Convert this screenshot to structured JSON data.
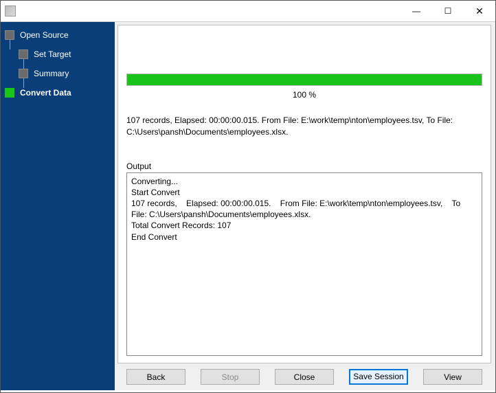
{
  "sidebar": {
    "items": [
      {
        "label": "Open Source",
        "active": false,
        "sub": false
      },
      {
        "label": "Set Target",
        "active": false,
        "sub": true
      },
      {
        "label": "Summary",
        "active": false,
        "sub": true
      },
      {
        "label": "Convert Data",
        "active": true,
        "sub": false
      }
    ]
  },
  "progress": {
    "percent_text": "100 %",
    "percent_value": 100
  },
  "status_line": "107 records,    Elapsed: 00:00:00.015.    From File: E:\\work\\temp\\nton\\employees.tsv,    To File: C:\\Users\\pansh\\Documents\\employees.xlsx.",
  "output_label": "Output",
  "output_text": "Converting...\nStart Convert\n107 records,    Elapsed: 00:00:00.015.    From File: E:\\work\\temp\\nton\\employees.tsv,    To File: C:\\Users\\pansh\\Documents\\employees.xlsx.\nTotal Convert Records: 107\nEnd Convert",
  "buttons": {
    "back": "Back",
    "stop": "Stop",
    "close": "Close",
    "save_session": "Save Session",
    "view": "View"
  }
}
